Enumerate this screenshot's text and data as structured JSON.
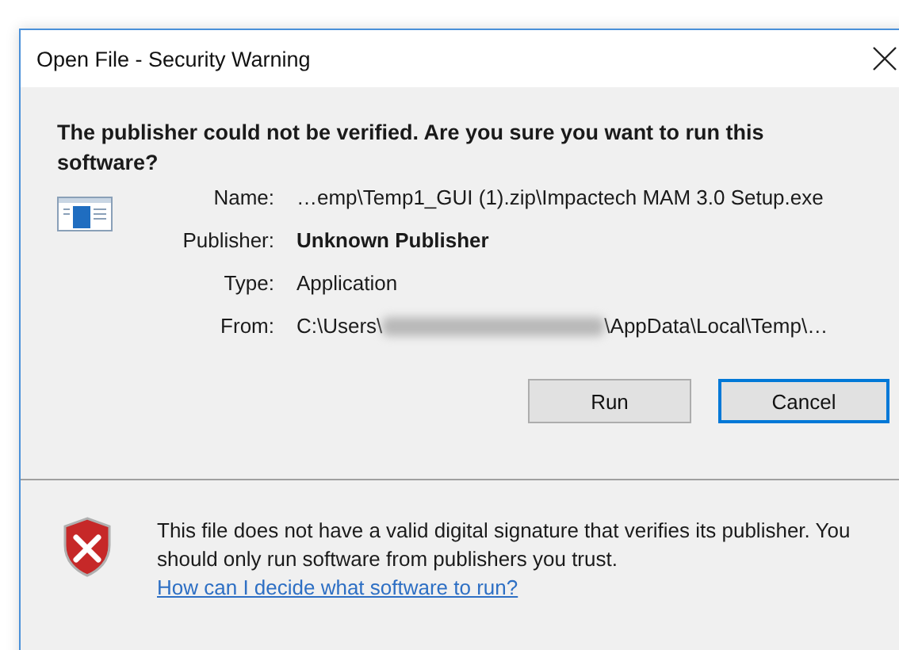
{
  "window": {
    "title": "Open File - Security Warning"
  },
  "heading": "The publisher could not be verified.  Are you sure you want to run this software?",
  "fields": [
    {
      "label": "Name:",
      "value": "…emp\\Temp1_GUI (1).zip\\Impactech MAM 3.0 Setup.exe",
      "kind": "plain"
    },
    {
      "label": "Publisher:",
      "value": "Unknown Publisher",
      "kind": "bold"
    },
    {
      "label": "Type:",
      "value": "Application",
      "kind": "plain"
    },
    {
      "label": "From:",
      "value": "C:\\Users\\",
      "value_after": "\\AppData\\Local\\Temp\\…",
      "kind": "redacted"
    }
  ],
  "buttons": [
    {
      "label": "Run",
      "default": false
    },
    {
      "label": "Cancel",
      "default": true
    }
  ],
  "footer": {
    "message": "This file does not have a valid digital signature that verifies its publisher.  You should only run software from publishers you trust.",
    "link": "How can I decide what software to run?"
  }
}
